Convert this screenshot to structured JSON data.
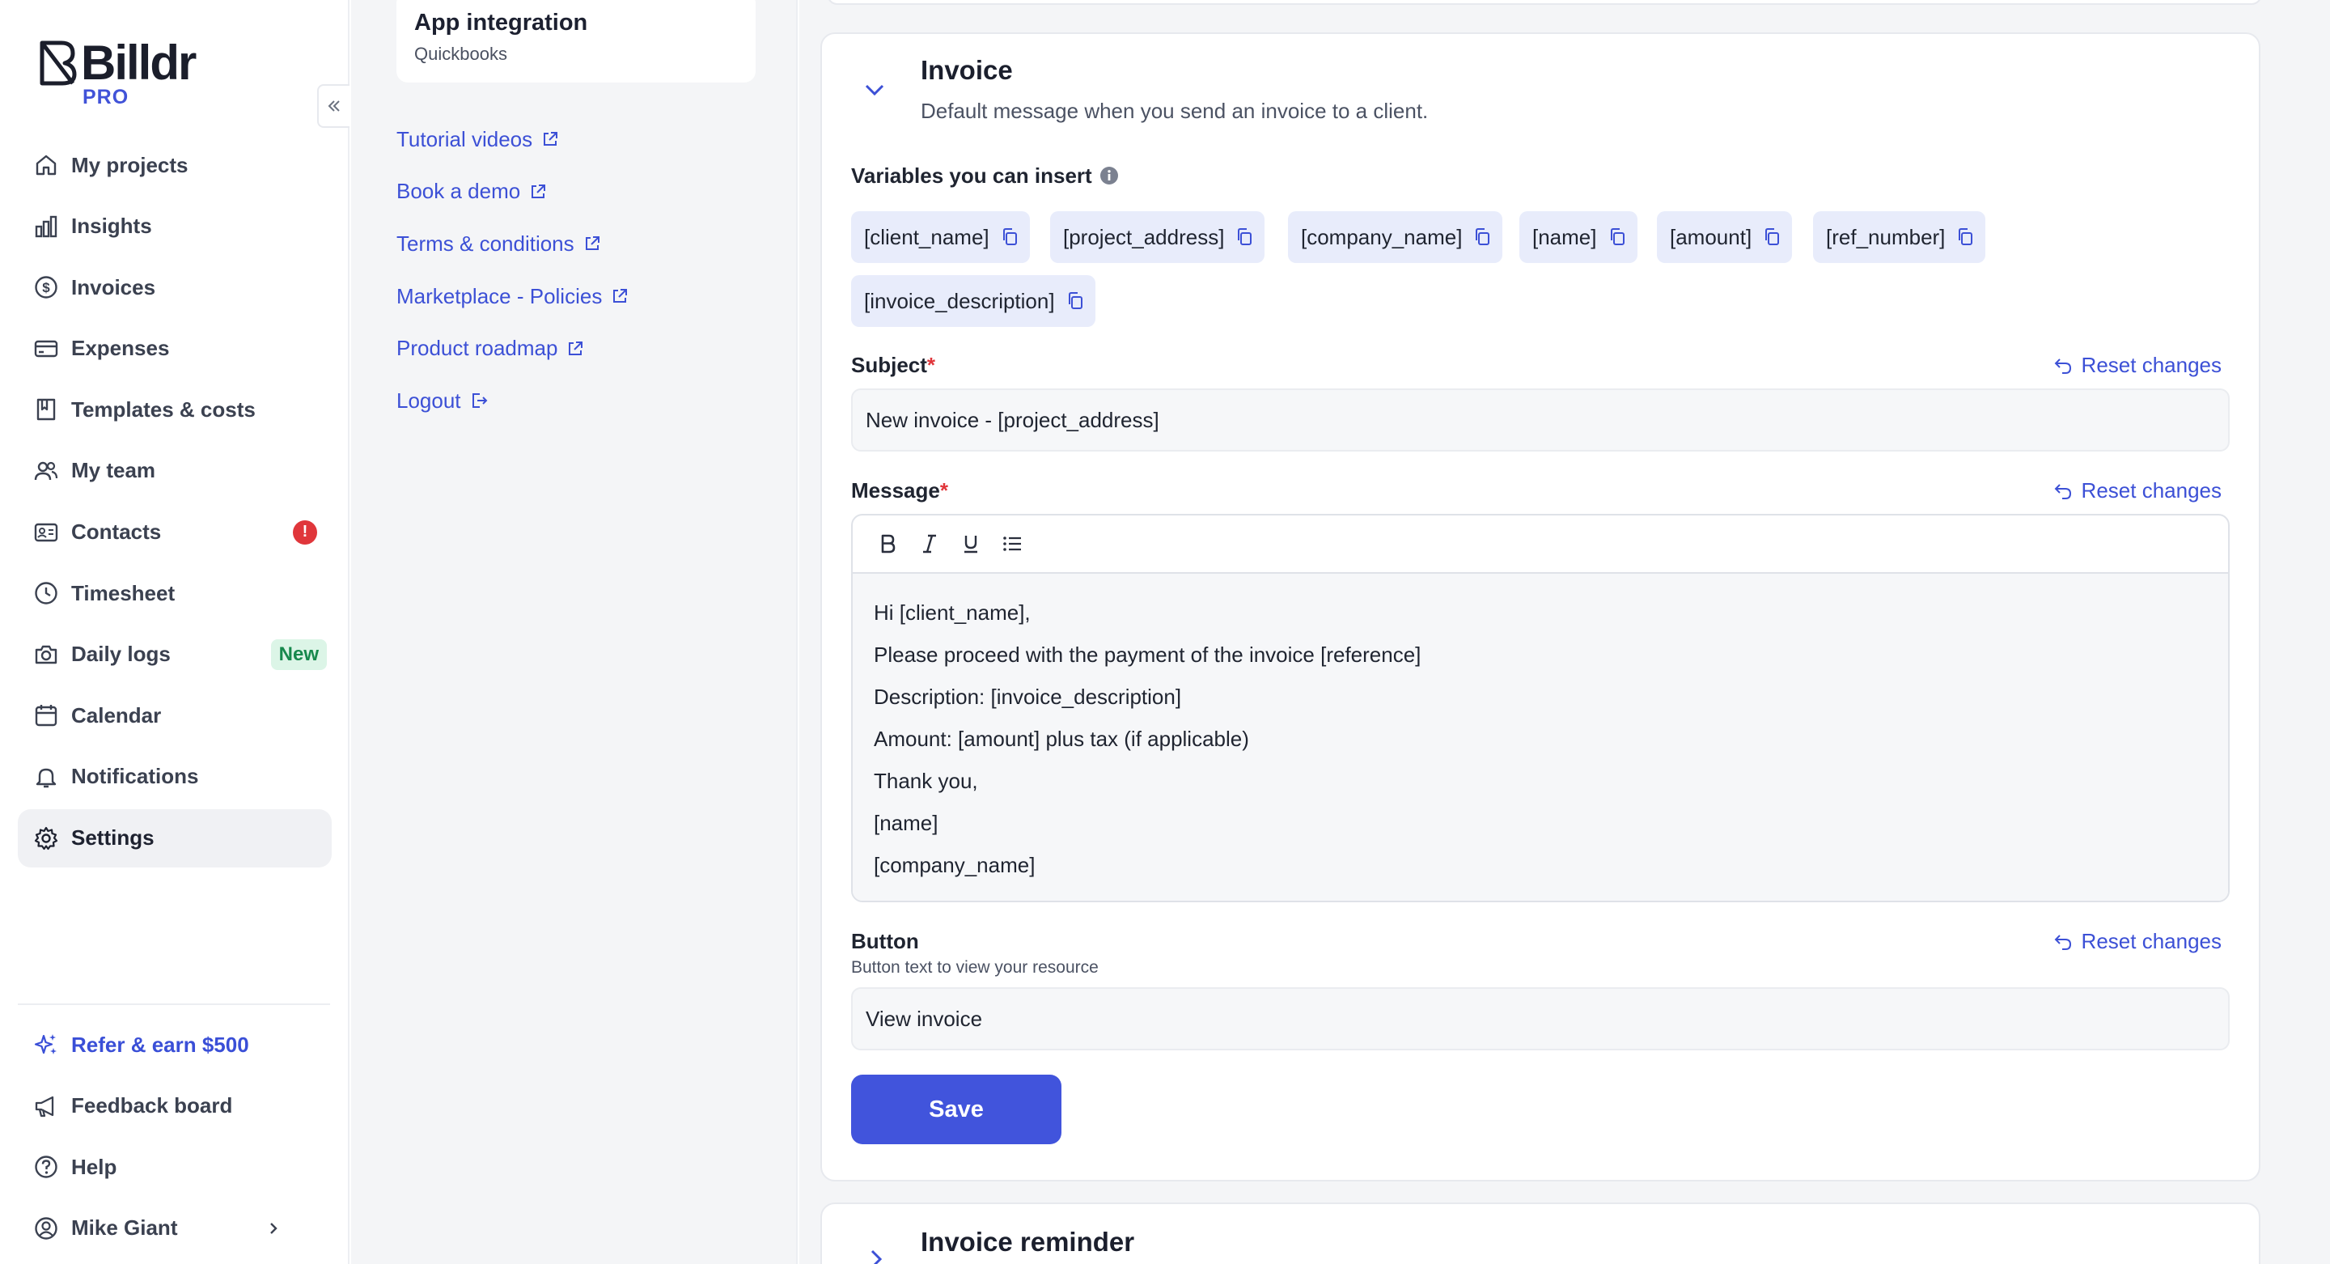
{
  "brand": {
    "name": "Billdr",
    "tier": "PRO",
    "accent": "#4154dc"
  },
  "sidebar": {
    "items": [
      {
        "label": "My projects",
        "icon": "home-icon"
      },
      {
        "label": "Insights",
        "icon": "bar-chart-icon"
      },
      {
        "label": "Invoices",
        "icon": "dollar-circle-icon"
      },
      {
        "label": "Expenses",
        "icon": "credit-card-icon"
      },
      {
        "label": "Templates & costs",
        "icon": "book-icon"
      },
      {
        "label": "My team",
        "icon": "users-icon"
      },
      {
        "label": "Contacts",
        "icon": "contact-card-icon",
        "alert": "!"
      },
      {
        "label": "Timesheet",
        "icon": "clock-icon"
      },
      {
        "label": "Daily logs",
        "icon": "camera-icon",
        "badge": "New"
      },
      {
        "label": "Calendar",
        "icon": "calendar-icon"
      },
      {
        "label": "Notifications",
        "icon": "bell-icon"
      },
      {
        "label": "Settings",
        "icon": "gear-icon",
        "active": true
      }
    ],
    "bottom": [
      {
        "label": "Refer & earn $500",
        "icon": "sparkle-icon"
      },
      {
        "label": "Feedback board",
        "icon": "megaphone-icon"
      },
      {
        "label": "Help",
        "icon": "help-circle-icon"
      },
      {
        "label": "Mike Giant",
        "icon": "user-circle-icon"
      }
    ]
  },
  "subnav": {
    "card": {
      "title": "App integration",
      "subtitle": "Quickbooks"
    },
    "links": [
      {
        "label": "Tutorial videos",
        "icon": "external-link-icon"
      },
      {
        "label": "Book a demo",
        "icon": "external-link-icon"
      },
      {
        "label": "Terms & conditions",
        "icon": "external-link-icon"
      },
      {
        "label": "Marketplace - Policies",
        "icon": "external-link-icon"
      },
      {
        "label": "Product roadmap",
        "icon": "external-link-icon"
      },
      {
        "label": "Logout",
        "icon": "logout-icon"
      }
    ]
  },
  "invoice": {
    "title": "Invoice",
    "description": "Default message when you send an invoice to a client.",
    "variables_label": "Variables you can insert",
    "variables": [
      "[client_name]",
      "[project_address]",
      "[company_name]",
      "[name]",
      "[amount]",
      "[ref_number]",
      "[invoice_description]"
    ],
    "subject_label": "Subject",
    "subject_value": "New invoice - [project_address]",
    "message_label": "Message",
    "message_lines": [
      "Hi [client_name],",
      "Please proceed with the payment of the invoice [reference]",
      "Description: [invoice_description]",
      "Amount: [amount] plus tax (if applicable)",
      "Thank you,",
      "[name]",
      "[company_name]"
    ],
    "button_label": "Button",
    "button_sublabel": "Button text to view your resource",
    "button_value": "View invoice",
    "reset_label": "Reset changes",
    "required_mark": "*",
    "save_label": "Save"
  },
  "invoice_reminder": {
    "title": "Invoice reminder"
  }
}
